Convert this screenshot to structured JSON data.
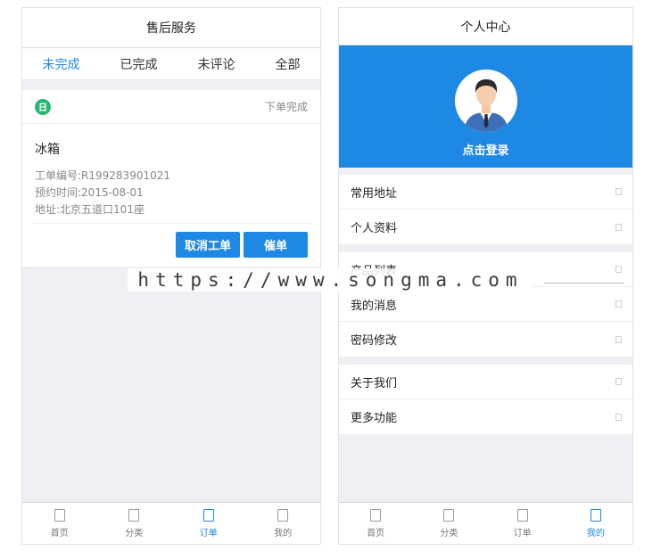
{
  "left": {
    "title": "售后服务",
    "tabs": [
      {
        "label": "未完成",
        "active": true
      },
      {
        "label": "已完成",
        "active": false
      },
      {
        "label": "未评论",
        "active": false
      },
      {
        "label": "全部",
        "active": false
      }
    ],
    "order": {
      "badge_text": "日",
      "status": "下单完成",
      "product": "冰箱",
      "work_no": "工单编号:R199283901021",
      "appointment": "预约时间:2015-08-01",
      "address": "地址:北京五道口101座",
      "cancel_label": "取消工单",
      "urge_label": "催单"
    },
    "tabbar": [
      {
        "label": "首页",
        "active": false
      },
      {
        "label": "分类",
        "active": false
      },
      {
        "label": "订单",
        "active": true
      },
      {
        "label": "我的",
        "active": false
      }
    ]
  },
  "right": {
    "title": "个人中心",
    "login_label": "点击登录",
    "groups": [
      [
        "常用地址",
        "个人资料"
      ],
      [
        "产品列表",
        "我的消息",
        "密码修改"
      ],
      [
        "关于我们",
        "更多功能"
      ]
    ],
    "tabbar": [
      {
        "label": "首页",
        "active": false
      },
      {
        "label": "分类",
        "active": false
      },
      {
        "label": "订单",
        "active": false
      },
      {
        "label": "我的",
        "active": true
      }
    ]
  },
  "watermark": "https://www.songma.com",
  "colors": {
    "accent": "#1e88e5",
    "badge": "#2bb673"
  }
}
